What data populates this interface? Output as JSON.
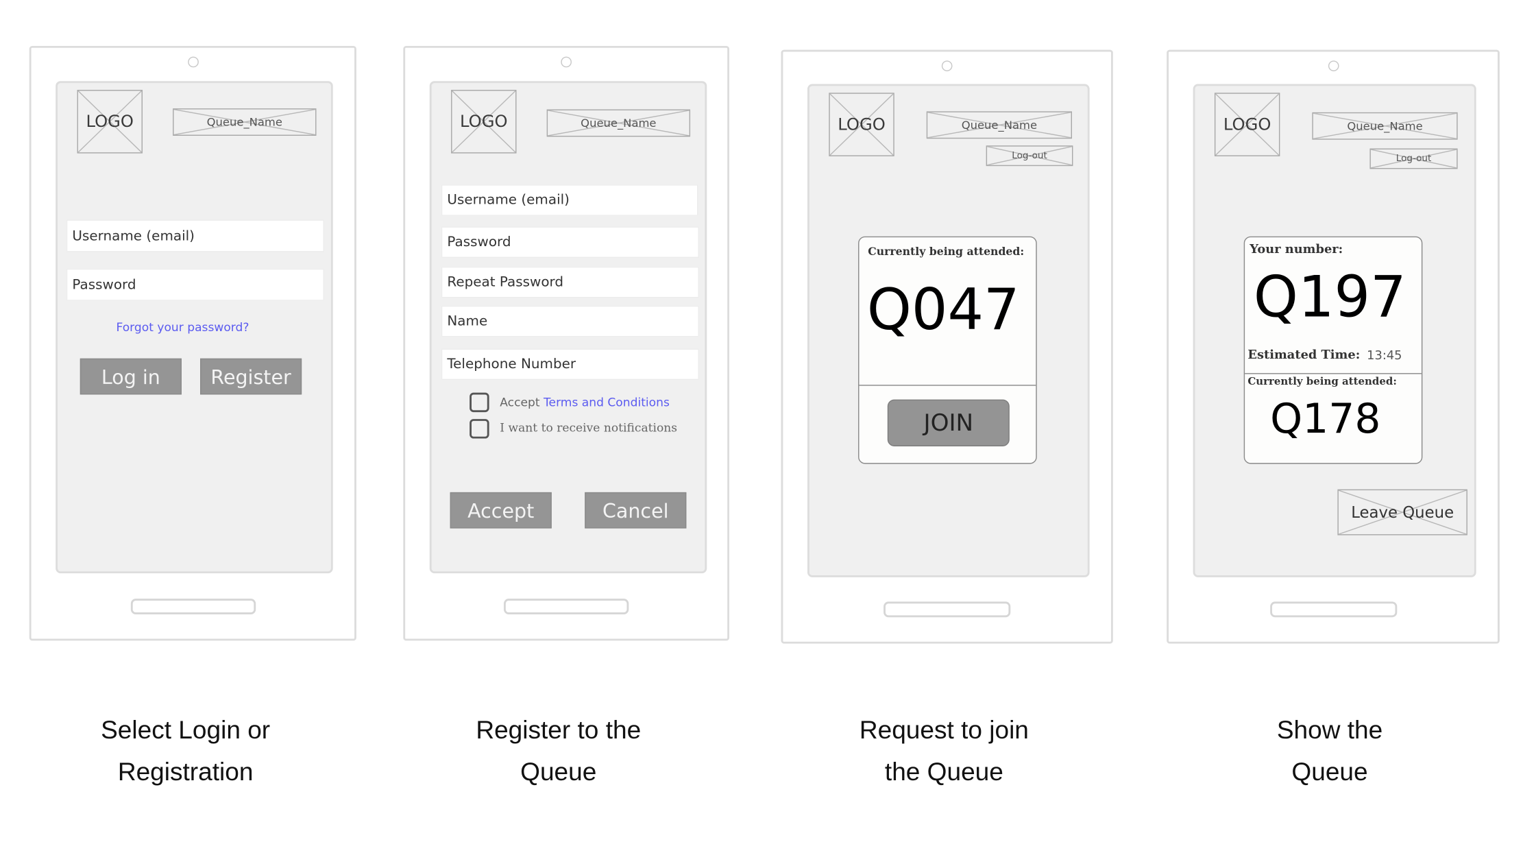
{
  "colors": {
    "screen_bg": "#f0f0f0",
    "button_gray": "#959595",
    "link_blue": "#5b5bf0"
  },
  "common": {
    "logo_label": "LOGO",
    "queue_name_label": "Queue_Name",
    "logout_label": "Log-out"
  },
  "screens": [
    {
      "id": "login",
      "caption_line1": "Select Login or",
      "caption_line2": "Registration",
      "fields": [
        "Username (email)",
        "Password"
      ],
      "forgot_link": "Forgot your password?",
      "buttons": [
        "Log in",
        "Register"
      ]
    },
    {
      "id": "register",
      "caption_line1": "Register to the",
      "caption_line2": "Queue",
      "fields": [
        "Username (email)",
        "Password",
        "Repeat Password",
        "Name",
        "Telephone Number"
      ],
      "checkboxes": [
        {
          "prefix": "Accept",
          "link": "Terms and Conditions",
          "checked": false
        },
        {
          "label": "I want to receive notifications",
          "checked": false
        }
      ],
      "buttons": [
        "Accept",
        "Cancel"
      ]
    },
    {
      "id": "join",
      "caption_line1": "Request to join",
      "caption_line2": "the Queue",
      "attended_label": "Currently being attended:",
      "attended_number": "Q047",
      "join_button": "JOIN"
    },
    {
      "id": "show",
      "caption_line1": "Show the",
      "caption_line2": "Queue",
      "your_number_label": "Your number:",
      "your_number": "Q197",
      "estimated_label": "Estimated Time:",
      "estimated_time": "13:45",
      "attended_label": "Currently being attended:",
      "attended_number": "Q178",
      "leave_button": "Leave Queue"
    }
  ]
}
